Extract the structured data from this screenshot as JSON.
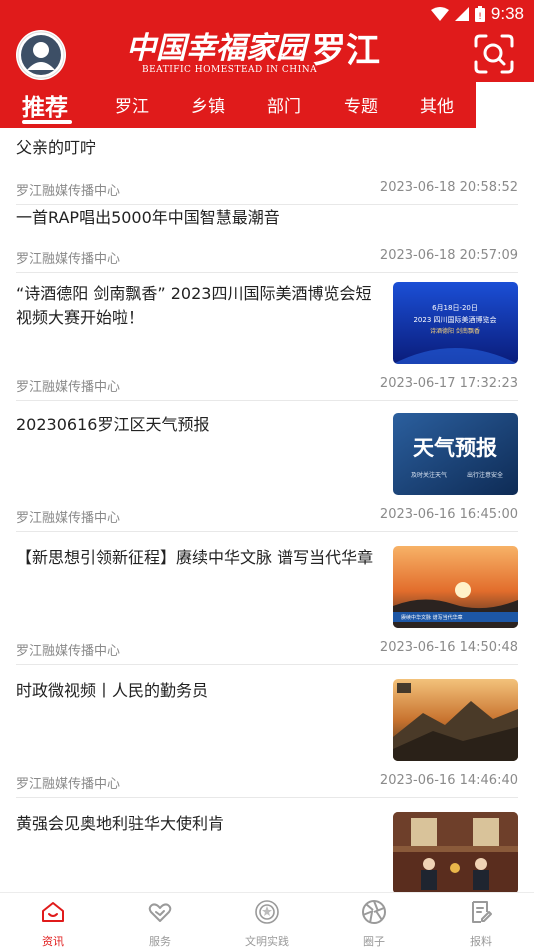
{
  "status_bar": {
    "time": "9:38"
  },
  "header": {
    "brand_main": "中国幸福家园",
    "brand_sub": "BEATIFIC HOMESTEAD IN CHINA",
    "brand_place": "罗江",
    "avatar_icon": "user-avatar-icon",
    "search_icon": "scan-search-icon"
  },
  "tabs": [
    {
      "label": "推荐",
      "active": true
    },
    {
      "label": "罗江"
    },
    {
      "label": "乡镇"
    },
    {
      "label": "部门"
    },
    {
      "label": "专题"
    },
    {
      "label": "其他"
    }
  ],
  "news": [
    {
      "title": "父亲的叮咛",
      "source": "罗江融媒传播中心",
      "time": "2023-06-18 20:58:52"
    },
    {
      "title": "一首RAP唱出5000年中国智慧最潮音",
      "source": "罗江融媒传播中心",
      "time": "2023-06-18 20:57:09"
    },
    {
      "title": "“诗酒德阳 剑南飘香” 2023四川国际美酒博览会短视频大赛开始啦！",
      "source": "罗江融媒传播中心",
      "time": "2023-06-17 17:32:23",
      "thumb": {
        "line1": "6月18日-20日",
        "line2": "2023 四川国际美酒博览会",
        "line3": "诗酒德阳 剑南飘香"
      }
    },
    {
      "title": "20230616罗江区天气预报",
      "source": "罗江融媒传播中心",
      "time": "2023-06-16 16:45:00",
      "thumb": {
        "line1": "天气预报",
        "line2": "及时关注天气",
        "line3": "出行注意安全"
      }
    },
    {
      "title": "【新思想引领新征程】赓续中华文脉 谱写当代华章",
      "source": "罗江融媒传播中心",
      "time": "2023-06-16 14:50:48",
      "thumb": {
        "line1": "赓续中华文脉 谱写当代华章"
      }
    },
    {
      "title": "时政微视频丨人民的勤务员",
      "source": "罗江融媒传播中心",
      "time": "2023-06-16 14:46:40"
    },
    {
      "title": "黄强会见奥地利驻华大使利肯",
      "source": "",
      "time": ""
    }
  ],
  "bottom_nav": [
    {
      "label": "资讯",
      "icon": "home-icon",
      "active": true
    },
    {
      "label": "服务",
      "icon": "handshake-heart-icon"
    },
    {
      "label": "文明实践",
      "icon": "emblem-icon"
    },
    {
      "label": "圈子",
      "icon": "aperture-icon"
    },
    {
      "label": "报料",
      "icon": "edit-note-icon"
    }
  ],
  "colors": {
    "brand_red": "#e01b1b",
    "meta_gray": "#8a8a8a"
  }
}
